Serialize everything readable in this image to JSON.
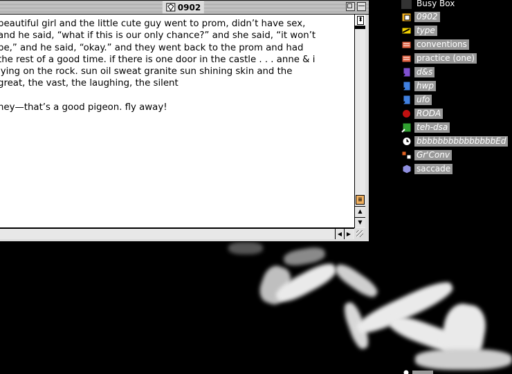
{
  "window": {
    "title": "0902",
    "text_lines": [
      "beautiful girl and the little cute guy went to prom, didn’t have sex,",
      "and he said, “what if this is our only chance?” and she said, “it won’t",
      "be,” and he said, “okay.” and they went back to the prom and had",
      "the rest of a good time. if there is one door in the castle . . . anne & i",
      "lying on the rock. sun oil sweat granite sun shining skin and the",
      "great, the vast, the laughing, the silent"
    ],
    "last_line": "hey—that’s a good pigeon. fly away!"
  },
  "desktop": {
    "items": [
      {
        "label": "Busy Box",
        "icon": "busy-box-icon",
        "italic": false
      },
      {
        "label": "0902",
        "icon": "folder-document-icon",
        "italic": true
      },
      {
        "label": "type",
        "icon": "pencil-alias-icon",
        "italic": true
      },
      {
        "label": "conventions",
        "icon": "book-icon",
        "italic": false
      },
      {
        "label": "practice (one)",
        "icon": "book-icon",
        "italic": false
      },
      {
        "label": "d&s",
        "icon": "app-alias-icon",
        "italic": true
      },
      {
        "label": "hwp",
        "icon": "app-alias-icon",
        "italic": true
      },
      {
        "label": "ufo",
        "icon": "app-alias-icon",
        "italic": true
      },
      {
        "label": "RODA",
        "icon": "red-sphere-icon",
        "italic": true
      },
      {
        "label": "teh-dsa",
        "icon": "green-alias-icon",
        "italic": true
      },
      {
        "label": "bbbbbbbbbbbbbbbEd",
        "icon": "clock-alias-icon",
        "italic": true
      },
      {
        "label": "Gr'Conv",
        "icon": "converter-icon",
        "italic": true
      },
      {
        "label": "saccade",
        "icon": "cube-icon",
        "italic": false
      }
    ]
  },
  "colors": {
    "desktop_bg": "#000000",
    "label_bg": "#999999",
    "scroll_thumb": "#f0b060"
  }
}
